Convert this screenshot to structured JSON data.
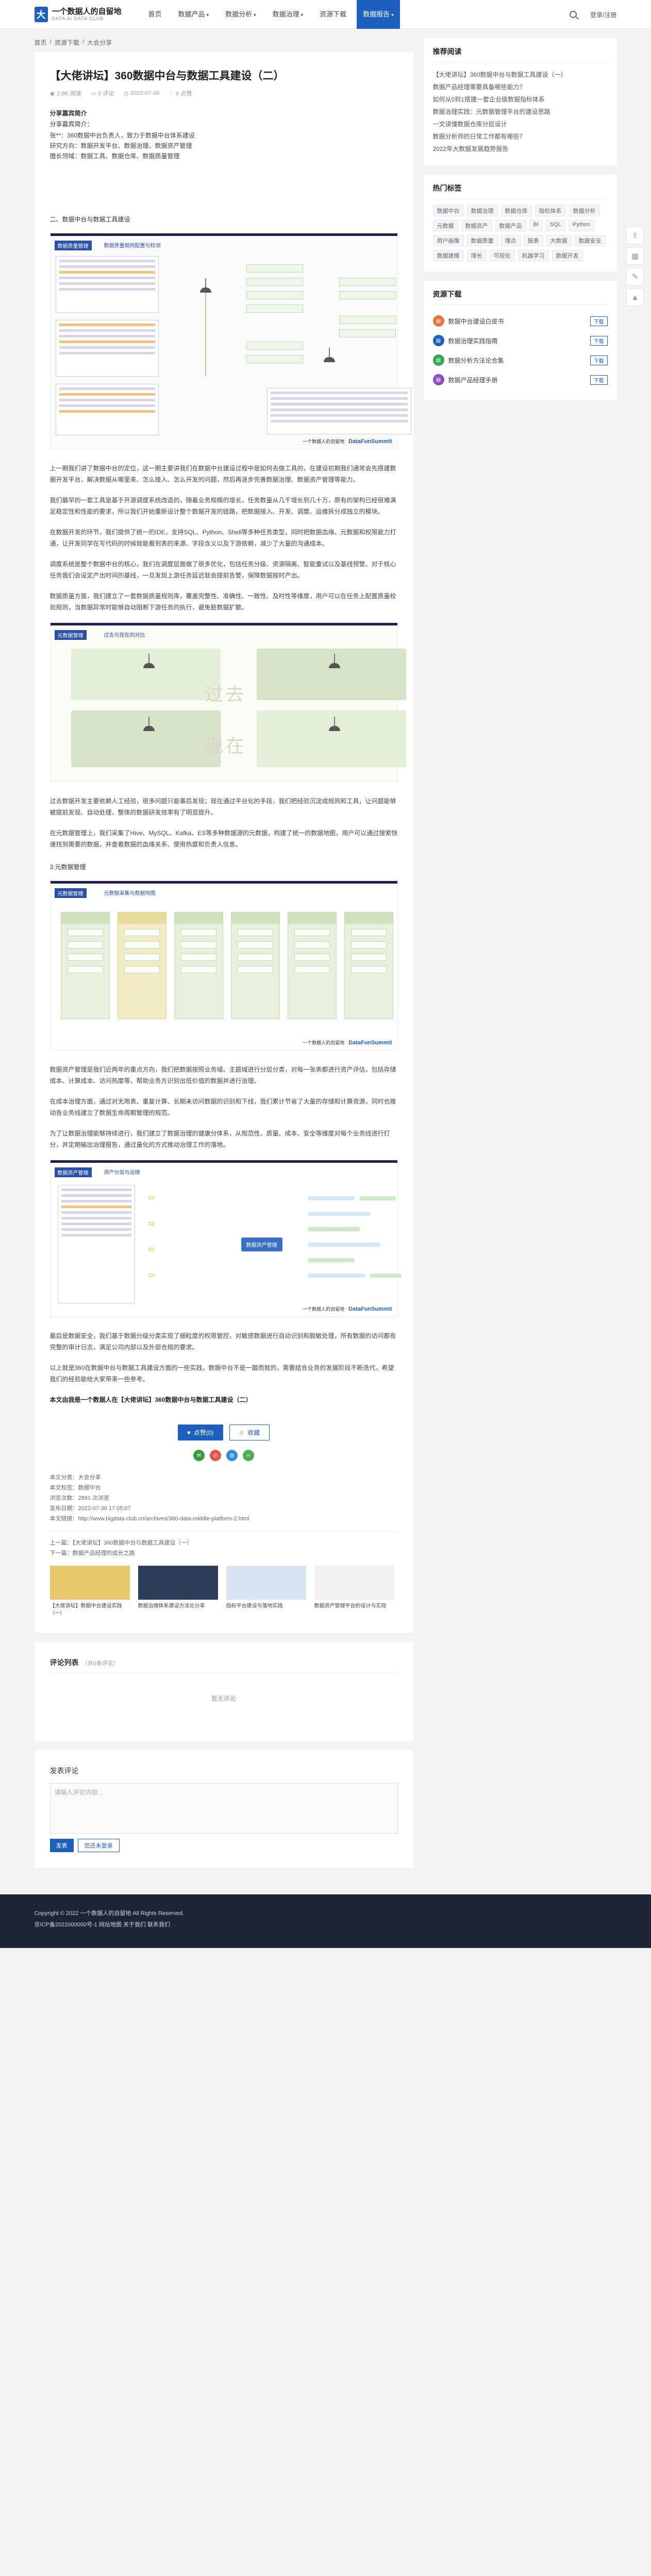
{
  "site": {
    "logo_char": "大",
    "title": "一个数据人的自留地",
    "subtitle": "DATA AI DATA CLUB"
  },
  "nav": {
    "items": [
      {
        "label": "首页",
        "caret": ""
      },
      {
        "label": "数据产品",
        "caret": "▾"
      },
      {
        "label": "数据分析",
        "caret": "▾"
      },
      {
        "label": "数据治理",
        "caret": "▾"
      },
      {
        "label": "资源下载",
        "caret": ""
      },
      {
        "label": "数据报告",
        "caret": "▾"
      }
    ],
    "active_index": 5,
    "login": "登录/注册"
  },
  "breadcrumb": [
    "首页",
    "/",
    "资源下载",
    "/",
    "大会分享"
  ],
  "article": {
    "title": "【大佬讲坛】360数据中台与数据工具建设（二）",
    "meta_views": "2.9K 阅读",
    "meta_comments": "0 评论",
    "meta_date": "2022-07-30",
    "meta_likes": "0 点赞",
    "intro_label": "分享嘉宾简介",
    "intro_label2": "分享嘉宾简介：",
    "intro_lines": [
      "张**：360数据中台负责人，致力于数据中台体系建设",
      "研究方向：数据开发平台、数据治理、数据资产管理",
      "擅长领域：数据工具、数据仓库、数据质量管理"
    ],
    "section_heading": "二、数据中台与数据工具建设",
    "paragraphs": [
      "上一期我们讲了数据中台的定位，这一期主要讲我们在数据中台建设过程中是如何去做工具的，在建设初期我们通常会先搭建数据开发平台，解决数据从哪里来、怎么接入、怎么开发的问题，然后再逐步完善数据治理、数据资产管理等能力。",
      "我们最早的一套工具是基于开源调度系统改造的，随着业务规模的增长，任务数量从几千增长到几十万，原有的架构已经很难满足稳定性和性能的要求，所以我们开始重新设计整个数据开发的链路，把数据接入、开发、调度、运维拆分成独立的模块。",
      "在数据开发的环节，我们提供了统一的IDE，支持SQL、Python、Shell等多种任务类型，同时把数据血缘、元数据和权限能力打通，让开发同学在写代码的时候就能看到表的来源、字段含义以及下游依赖，减少了大量的沟通成本。",
      "调度系统是整个数据中台的核心，我们在调度层面做了很多优化，包括任务分级、资源隔离、智能重试以及基线预警。对于核心任务我们会设定产出时间的基线，一旦发现上游任务延迟就会提前告警，保障数据按时产出。",
      "数据质量方面，我们建立了一套数据质量规则库，覆盖完整性、准确性、一致性、及时性等维度，用户可以在任务上配置质量校验规则，当数据异常时能够自动阻断下游任务的执行，避免脏数据扩散。",
      "过去数据开发主要依赖人工经验，很多问题只能事后发现；现在通过平台化的手段，我们把经验沉淀成规则和工具，让问题能够被提前发现、自动处理，整体的数据研发效率有了明显提升。",
      "在元数据管理上，我们采集了Hive、MySQL、Kafka、ES等多种数据源的元数据，构建了统一的数据地图，用户可以通过搜索快速找到需要的数据，并查看数据的血缘关系、使用热度和负责人信息。",
      "数据资产管理是我们近两年的重点方向，我们把数据按照业务域、主题域进行分层分类，对每一张表都进行资产评估，包括存储成本、计算成本、访问热度等，帮助业务方识别出低价值的数据并进行治理。",
      "在成本治理方面，通过对无用表、重复计算、长期未访问数据的识别和下线，我们累计节省了大量的存储和计算资源，同时也推动各业务线建立了数据生命周期管理的规范。",
      "为了让数据治理能够持续进行，我们建立了数据治理的健康分体系，从规范性、质量、成本、安全等维度对每个业务线进行打分，并定期输出治理报告，通过量化的方式推动治理工作的落地。",
      "最后是数据安全，我们基于数据分级分类实现了细粒度的权限管控，对敏感数据进行自动识别和脱敏处理，所有数据的访问都有完整的审计日志，满足公司内部以及外部合规的要求。",
      "以上就是360在数据中台与数据工具建设方面的一些实践，数据中台不是一蹴而就的，需要结合业务的发展阶段不断迭代，希望我们的经验能给大家带来一些参考。"
    ],
    "section_heading2": "3.元数据管理",
    "footnote": "本文由我是一个数据人在【大佬讲坛】360数据中台与数据工具建设（二）",
    "like_label": "点赞(0)",
    "fav_label": "收藏",
    "info": [
      "本文分类：大会分享",
      "本文标签：数据中台",
      "浏览次数：2891 次浏览",
      "发布日期：2022-07-30 17:05:07",
      "本文链接：http://www.bigdata-club.cn/archives/360-data-middle-platform-2.html"
    ],
    "prev": "上一篇：【大佬讲坛】360数据中台与数据工具建设（一）",
    "next": "下一篇：数据产品经理的成长之路"
  },
  "figures": {
    "fig1_tag": "数据质量管理",
    "fig1_sub": "数据质量规则配置与检测",
    "fig2_tag": "元数据管理",
    "fig2_sub": "过去与现在的对比",
    "fig2_past": "过去",
    "fig2_now": "现在",
    "fig3_tag": "元数据管理",
    "fig3_sub": "元数据采集与数据地图",
    "fig4_tag": "数据资产管理",
    "fig4_sub": "资产分层与治理",
    "fig4_center": "数据资产管理",
    "brand_prefix": "一个数据人的自留地",
    "brand": "DataFunSummit"
  },
  "related": [
    {
      "caption": "【大佬讲坛】数据中台建设实践（一）"
    },
    {
      "caption": "数据治理体系建设方法论分享"
    },
    {
      "caption": "指标平台建设与落地实践"
    },
    {
      "caption": "数据资产管理平台的设计与实现"
    }
  ],
  "comments": {
    "title": "评论列表",
    "count": "（共0条评论）",
    "empty": "暂无评论",
    "form_title": "发表评论",
    "placeholder": "请输入评论内容...",
    "submit": "发表",
    "login": "您还未登录"
  },
  "sidebar": {
    "rec_title": "推荐阅读",
    "rec_items": [
      "【大佬讲坛】360数据中台与数据工具建设（一）",
      "数据产品经理需要具备哪些能力？",
      "如何从0到1搭建一套企业级数据指标体系",
      "数据治理实践：元数据管理平台的建设思路",
      "一文读懂数据仓库分层设计",
      "数据分析师的日常工作都有哪些？",
      "2022年大数据发展趋势报告"
    ],
    "tags_title": "热门标签",
    "tags": [
      "数据中台",
      "数据治理",
      "数据仓库",
      "指标体系",
      "数据分析",
      "元数据",
      "数据资产",
      "数据产品",
      "BI",
      "SQL",
      "Python",
      "用户画像",
      "数据质量",
      "埋点",
      "报表",
      "大数据",
      "数据安全",
      "数据建模",
      "增长",
      "可视化",
      "机器学习",
      "数据开发"
    ],
    "dl_title": "资源下载",
    "dl_items": [
      {
        "name": "数据中台建设白皮书",
        "btn": "下载",
        "color": "#e8743b"
      },
      {
        "name": "数据治理实践指南",
        "btn": "下载",
        "color": "#1c5fbf"
      },
      {
        "name": "数据分析方法论合集",
        "btn": "下载",
        "color": "#2fa84f"
      },
      {
        "name": "数据产品经理手册",
        "btn": "下载",
        "color": "#8a4fc8"
      }
    ]
  },
  "footer": {
    "line1": "Copyright © 2022 一个数据人的自留地 All Rights Reserved.",
    "line2": "京ICP备2022000000号-1  网站地图  关于我们  联系我们"
  }
}
